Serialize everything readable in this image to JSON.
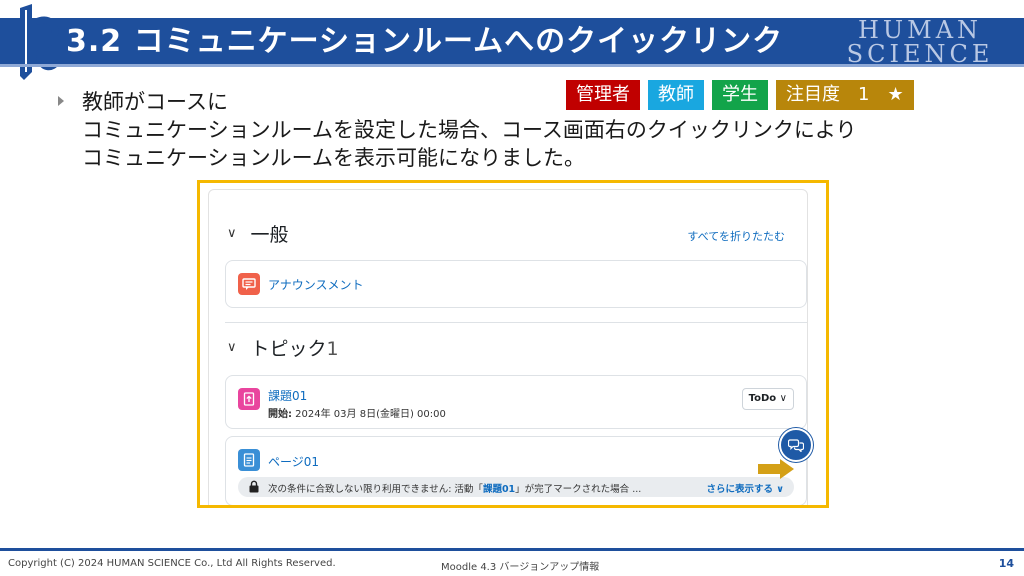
{
  "slide": {
    "title": "3.2 コミュニケーションルームへのクイックリンク",
    "brand_line1": "HUMAN",
    "brand_line2": "SCIENCE",
    "badges": [
      {
        "label": "管理者",
        "color": "#c00000"
      },
      {
        "label": "教師",
        "color": "#19a7e0"
      },
      {
        "label": "学生",
        "color": "#12a44a"
      },
      {
        "label": "注目度　1　★",
        "color": "#b8860b"
      }
    ],
    "description": [
      "教師がコースに",
      "コミュニケーションルームを設定した場合、コース画面右のクイックリンクにより",
      "コミュニケーションルームを表示可能になりました。"
    ]
  },
  "moodle": {
    "section_general": "一般",
    "collapse_all": "すべてを折りたたむ",
    "announcement": "アナウンスメント",
    "section_topic_label": "トピック",
    "section_topic_number": "1",
    "assignment": {
      "title": "課題01",
      "open_label": "開始:",
      "open_date": " 2024年 03月 8日(金曜日) 00:00",
      "todo": "ToDo"
    },
    "page": {
      "title": "ページ01",
      "restrict_prefix": "次の条件に合致しない限り利用できません: 活動「",
      "restrict_activity": "課題01",
      "restrict_suffix": "」が完了マークされた場合 ...",
      "show_more": "さらに表示する"
    },
    "quicklink_icon": "chat-bubbles-icon"
  },
  "footer": {
    "copyright": "Copyright (C) 2024 HUMAN SCIENCE Co., Ltd All Rights Reserved.",
    "subject": "Moodle 4.3 バージョンアップ情報",
    "page": "14"
  }
}
